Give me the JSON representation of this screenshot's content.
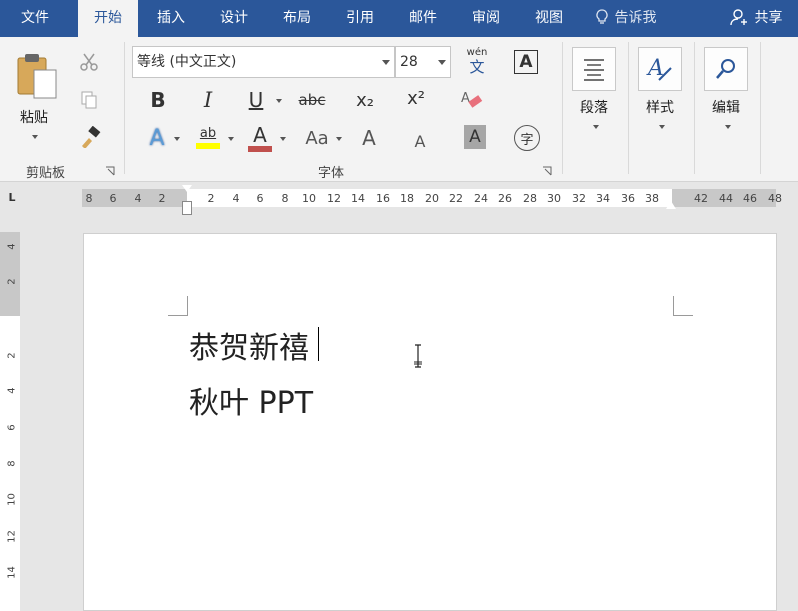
{
  "tabs": [
    "文件",
    "开始",
    "插入",
    "设计",
    "布局",
    "引用",
    "邮件",
    "审阅",
    "视图"
  ],
  "tell_me": "告诉我",
  "share": "共享",
  "clipboard": {
    "paste_label": "粘贴",
    "group_label": "剪贴板"
  },
  "font": {
    "name": "等线 (中文正文)",
    "size": "28",
    "phonetic_top": "wén",
    "phonetic_bottom": "文",
    "group_label": "字体",
    "bold": "B",
    "italic": "I",
    "underline": "U",
    "strike": "abc",
    "subscript": "x₂",
    "superscript": "x²",
    "highlight": "ab",
    "font_color": "A",
    "change_case": "Aa",
    "grow": "A",
    "shrink": "A",
    "char_shading": "A",
    "enclose": "字",
    "char_border": "A"
  },
  "paragraph": {
    "label": "段落"
  },
  "styles": {
    "label": "样式"
  },
  "editing": {
    "label": "编辑"
  },
  "ruler": {
    "tab_stop_glyph": "L",
    "left_numbers": [
      "8",
      "6",
      "4",
      "2"
    ],
    "right_numbers": [
      "2",
      "4",
      "6",
      "8",
      "10",
      "12",
      "14",
      "16",
      "18",
      "20",
      "22",
      "24",
      "26",
      "28",
      "30",
      "32",
      "34",
      "36",
      "38",
      "42",
      "44",
      "46",
      "48"
    ],
    "vertical_numbers": [
      "4",
      "2",
      "2",
      "4",
      "6",
      "8",
      "10",
      "12",
      "14"
    ]
  },
  "document": {
    "line1": "恭贺新禧",
    "line2": "秋叶 PPT"
  },
  "colors": {
    "accent": "#2b579a",
    "highlight": "#ffff00",
    "font_color_bar": "#c0504d"
  }
}
